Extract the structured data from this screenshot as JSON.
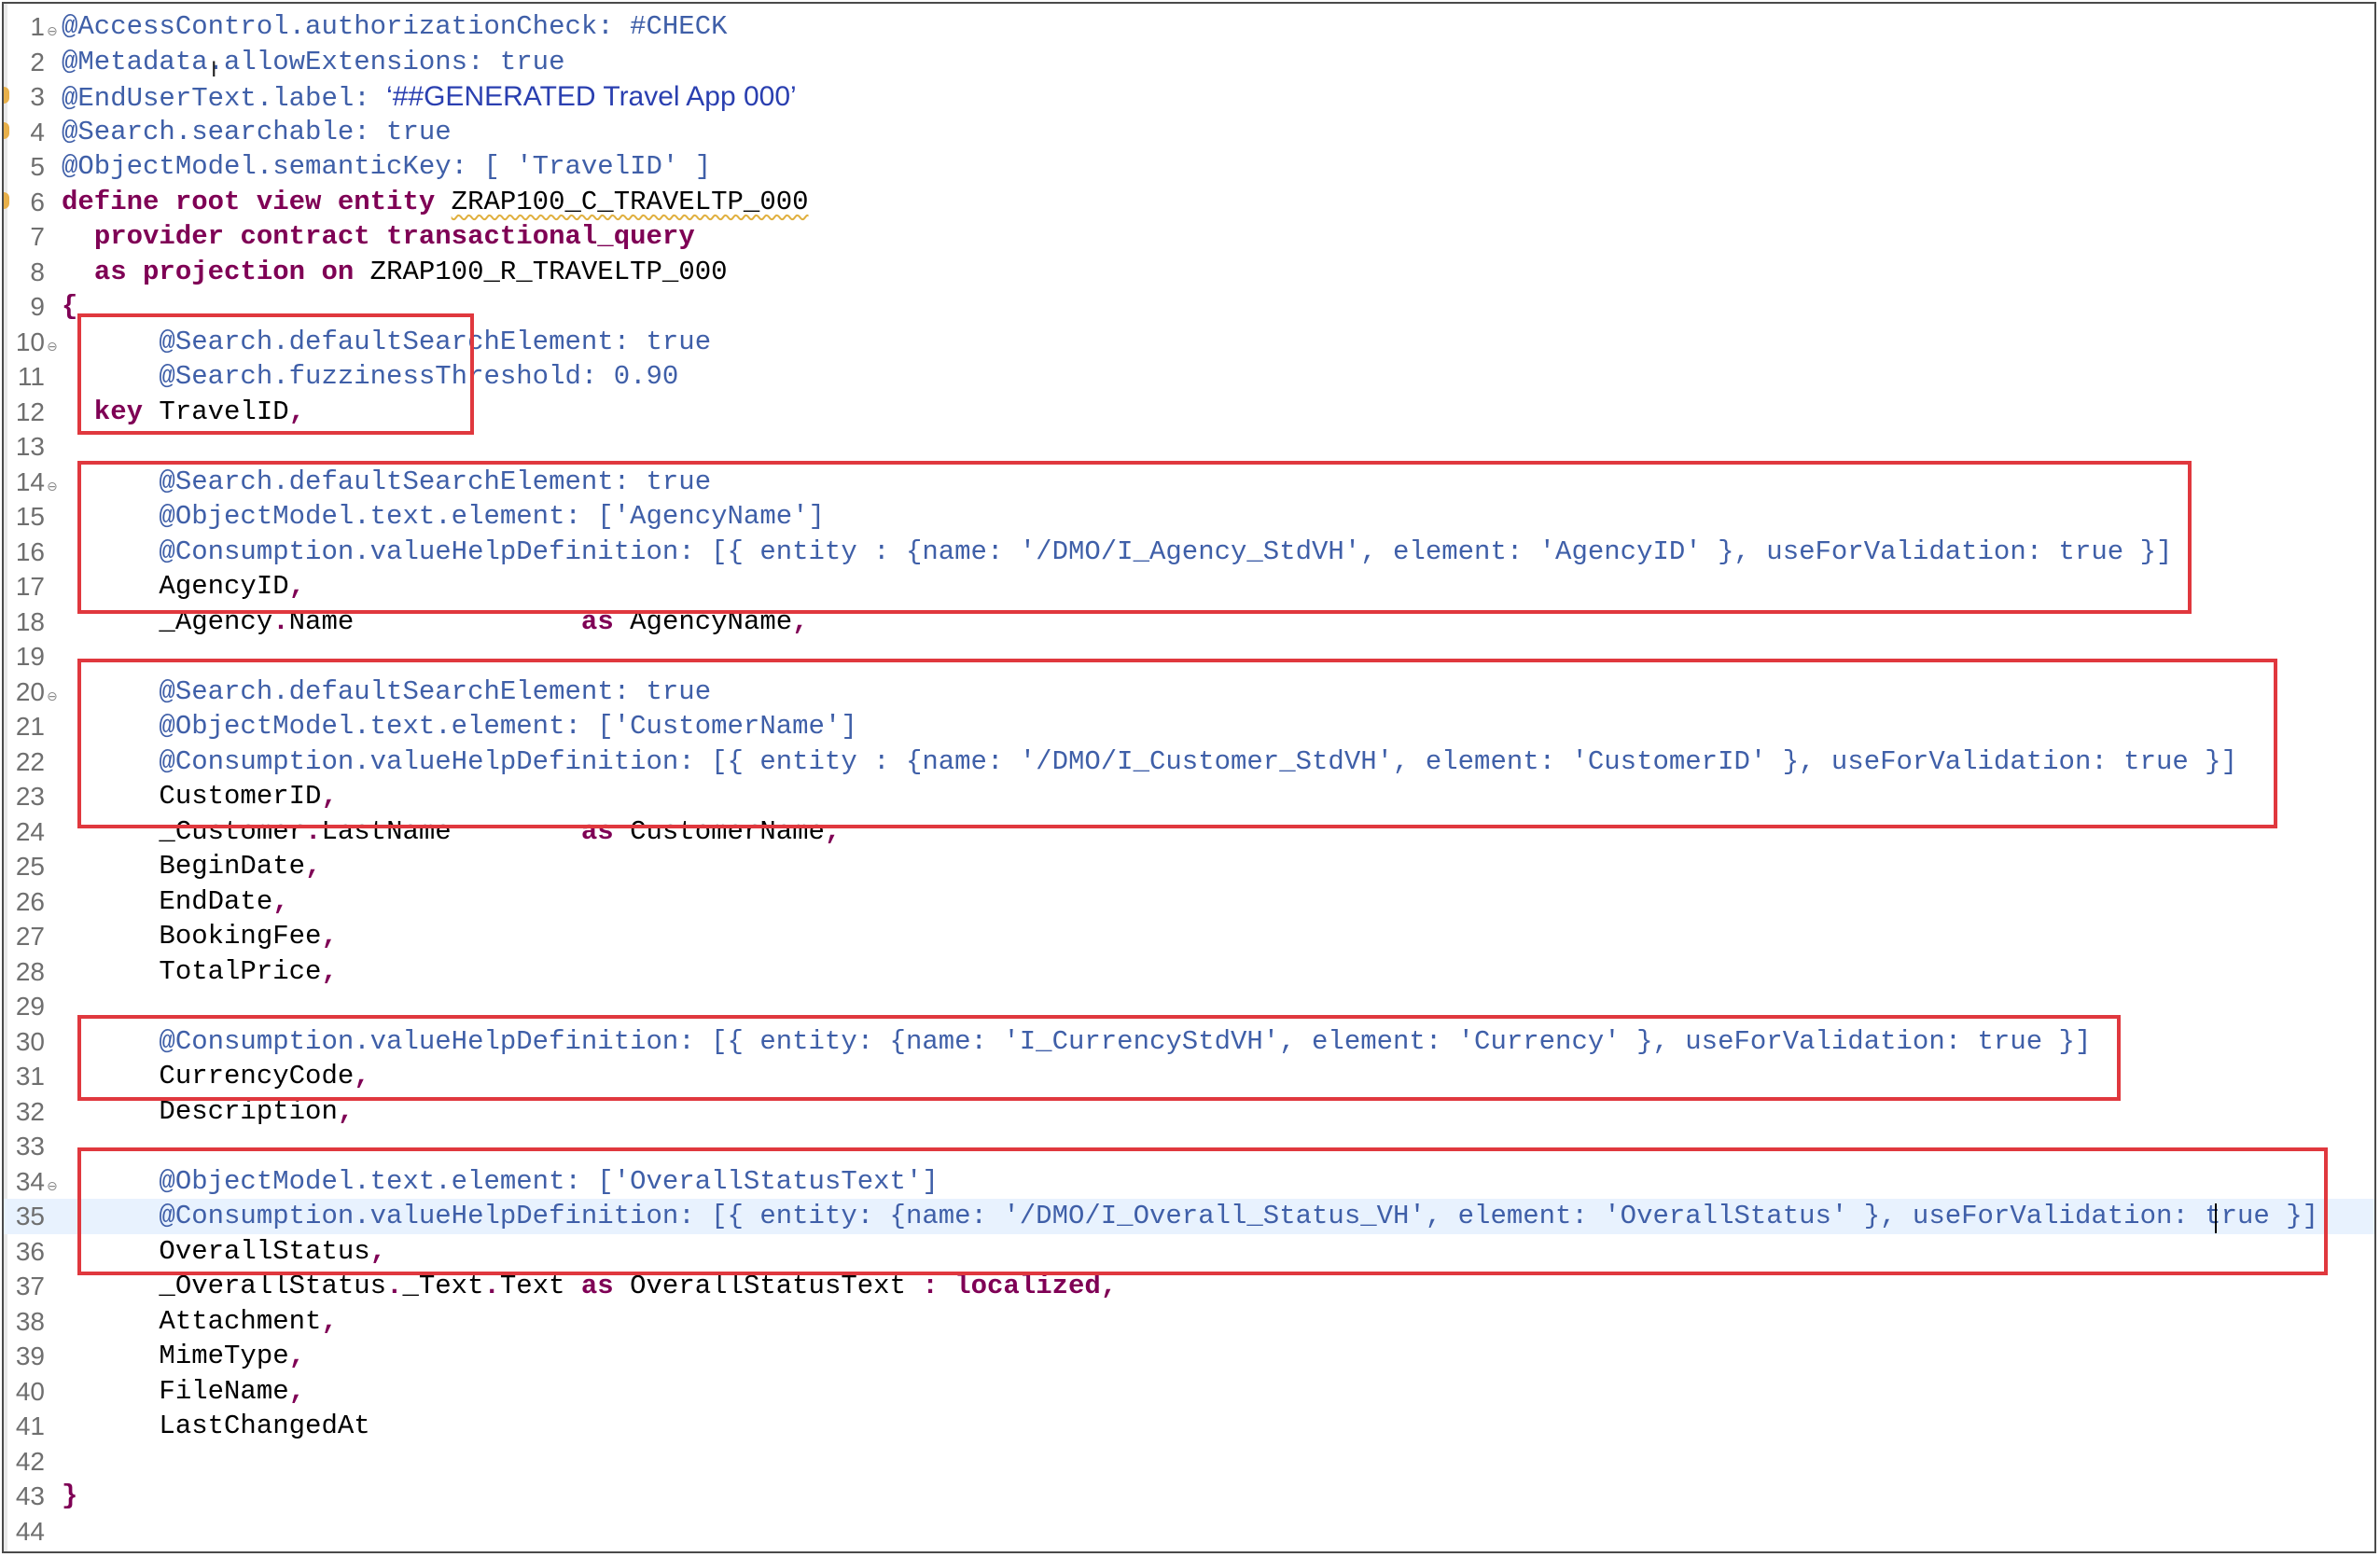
{
  "editor": {
    "current_line": 35,
    "lines": [
      {
        "n": "1",
        "t": [
          [
            "an",
            "@AccessControl.authorizationCheck: #CHECK"
          ]
        ]
      },
      {
        "n": "2",
        "t": [
          [
            "an",
            "@Metadata.allowExtensions: true"
          ]
        ]
      },
      {
        "n": "3",
        "t": [
          [
            "an",
            "@EndUserText.label: "
          ],
          [
            "sans",
            "‘##GENERATED Travel App 000’"
          ]
        ]
      },
      {
        "n": "4",
        "t": [
          [
            "an",
            "@Search.searchable: true"
          ]
        ]
      },
      {
        "n": "5",
        "t": [
          [
            "an",
            "@ObjectModel.semanticKey: [ 'TravelID' ]"
          ]
        ]
      },
      {
        "n": "6",
        "t": [
          [
            "kw",
            "define root view entity "
          ],
          [
            "id squig",
            "ZRAP100_C_TRAVELTP_000"
          ]
        ]
      },
      {
        "n": "7",
        "t": [
          [
            "id",
            "  "
          ],
          [
            "kw",
            "provider contract transactional_query"
          ]
        ]
      },
      {
        "n": "8",
        "t": [
          [
            "id",
            "  "
          ],
          [
            "kw",
            "as projection on "
          ],
          [
            "id",
            "ZRAP100_R_TRAVELTP_000"
          ]
        ]
      },
      {
        "n": "9",
        "t": [
          [
            "pn",
            "{"
          ]
        ]
      },
      {
        "n": "10",
        "t": [
          [
            "an",
            "      @Search.defaultSearchElement: true"
          ]
        ]
      },
      {
        "n": "11",
        "t": [
          [
            "an",
            "      @Search.fuzzinessThreshold: 0.90"
          ]
        ]
      },
      {
        "n": "12",
        "t": [
          [
            "kw",
            "  key "
          ],
          [
            "id",
            "TravelID"
          ],
          [
            "pn",
            ","
          ]
        ]
      },
      {
        "n": "13",
        "t": []
      },
      {
        "n": "14",
        "t": [
          [
            "an",
            "      @Search.defaultSearchElement: true"
          ]
        ]
      },
      {
        "n": "15",
        "t": [
          [
            "an",
            "      @ObjectModel.text.element: ['AgencyName']"
          ]
        ]
      },
      {
        "n": "16",
        "t": [
          [
            "an",
            "      @Consumption.valueHelpDefinition: [{ entity : {name: '/DMO/I_Agency_StdVH', element: 'AgencyID' }, useForValidation: true }]"
          ]
        ]
      },
      {
        "n": "17",
        "t": [
          [
            "id",
            "      AgencyID"
          ],
          [
            "pn",
            ","
          ]
        ]
      },
      {
        "n": "18",
        "t": [
          [
            "id",
            "      _Agency"
          ],
          [
            "pn",
            "."
          ],
          [
            "id",
            "Name              "
          ],
          [
            "kw",
            "as "
          ],
          [
            "id",
            "AgencyName"
          ],
          [
            "pn",
            ","
          ]
        ]
      },
      {
        "n": "19",
        "t": []
      },
      {
        "n": "20",
        "t": [
          [
            "an",
            "      @Search.defaultSearchElement: true"
          ]
        ]
      },
      {
        "n": "21",
        "t": [
          [
            "an",
            "      @ObjectModel.text.element: ['CustomerName']"
          ]
        ]
      },
      {
        "n": "22",
        "t": [
          [
            "an",
            "      @Consumption.valueHelpDefinition: [{ entity : {name: '/DMO/I_Customer_StdVH', element: 'CustomerID' }, useForValidation: true }]"
          ]
        ]
      },
      {
        "n": "23",
        "t": [
          [
            "id",
            "      CustomerID"
          ],
          [
            "pn",
            ","
          ]
        ]
      },
      {
        "n": "24",
        "t": [
          [
            "id",
            "      _Customer"
          ],
          [
            "pn",
            "."
          ],
          [
            "id",
            "LastName        "
          ],
          [
            "kw",
            "as "
          ],
          [
            "id",
            "CustomerName"
          ],
          [
            "pn",
            ","
          ]
        ]
      },
      {
        "n": "25",
        "t": [
          [
            "id",
            "      BeginDate"
          ],
          [
            "pn",
            ","
          ]
        ]
      },
      {
        "n": "26",
        "t": [
          [
            "id",
            "      EndDate"
          ],
          [
            "pn",
            ","
          ]
        ]
      },
      {
        "n": "27",
        "t": [
          [
            "id",
            "      BookingFee"
          ],
          [
            "pn",
            ","
          ]
        ]
      },
      {
        "n": "28",
        "t": [
          [
            "id",
            "      TotalPrice"
          ],
          [
            "pn",
            ","
          ]
        ]
      },
      {
        "n": "29",
        "t": []
      },
      {
        "n": "30",
        "t": [
          [
            "an",
            "      @Consumption.valueHelpDefinition: [{ entity: {name: 'I_CurrencyStdVH', element: 'Currency' }, useForValidation: true }]"
          ]
        ]
      },
      {
        "n": "31",
        "t": [
          [
            "id",
            "      CurrencyCode"
          ],
          [
            "pn",
            ","
          ]
        ]
      },
      {
        "n": "32",
        "t": [
          [
            "id",
            "      Description"
          ],
          [
            "pn",
            ","
          ]
        ]
      },
      {
        "n": "33",
        "t": []
      },
      {
        "n": "34",
        "t": [
          [
            "an",
            "      @ObjectModel.text.element: ['OverallStatusText']"
          ]
        ]
      },
      {
        "n": "35",
        "t": [
          [
            "an",
            "      @Consumption.valueHelpDefinition: [{ entity: {name: '/DMO/I_Overall_Status_VH', element: 'OverallStatus' }, useForValidation: true }]"
          ]
        ]
      },
      {
        "n": "36",
        "t": [
          [
            "id",
            "      OverallStatus"
          ],
          [
            "pn",
            ","
          ]
        ]
      },
      {
        "n": "37",
        "t": [
          [
            "id",
            "      _OverallStatus"
          ],
          [
            "pn",
            "."
          ],
          [
            "id",
            "_Text"
          ],
          [
            "pn",
            "."
          ],
          [
            "id",
            "Text "
          ],
          [
            "kw",
            "as "
          ],
          [
            "id",
            "OverallStatusText "
          ],
          [
            "pn",
            ": "
          ],
          [
            "kw",
            "localized"
          ],
          [
            "pn",
            ","
          ]
        ]
      },
      {
        "n": "38",
        "t": [
          [
            "id",
            "      Attachment"
          ],
          [
            "pn",
            ","
          ]
        ]
      },
      {
        "n": "39",
        "t": [
          [
            "id",
            "      MimeType"
          ],
          [
            "pn",
            ","
          ]
        ]
      },
      {
        "n": "40",
        "t": [
          [
            "id",
            "      FileName"
          ],
          [
            "pn",
            ","
          ]
        ]
      },
      {
        "n": "41",
        "t": [
          [
            "id",
            "      LastChangedAt"
          ]
        ]
      },
      {
        "n": "42",
        "t": []
      },
      {
        "n": "43",
        "t": [
          [
            "pn",
            "}"
          ]
        ]
      },
      {
        "n": "44",
        "t": []
      }
    ]
  },
  "colors": {
    "annotation": "#3f5fa8",
    "keyword": "#7f0055",
    "identifier": "#000000",
    "highlight_box": "#e0383e",
    "current_line": "#e8f2fe"
  },
  "icons": {
    "fold": "collapse-fold-icon",
    "marker": "warning-marker-icon",
    "cursor": "ibeam-cursor-icon"
  }
}
